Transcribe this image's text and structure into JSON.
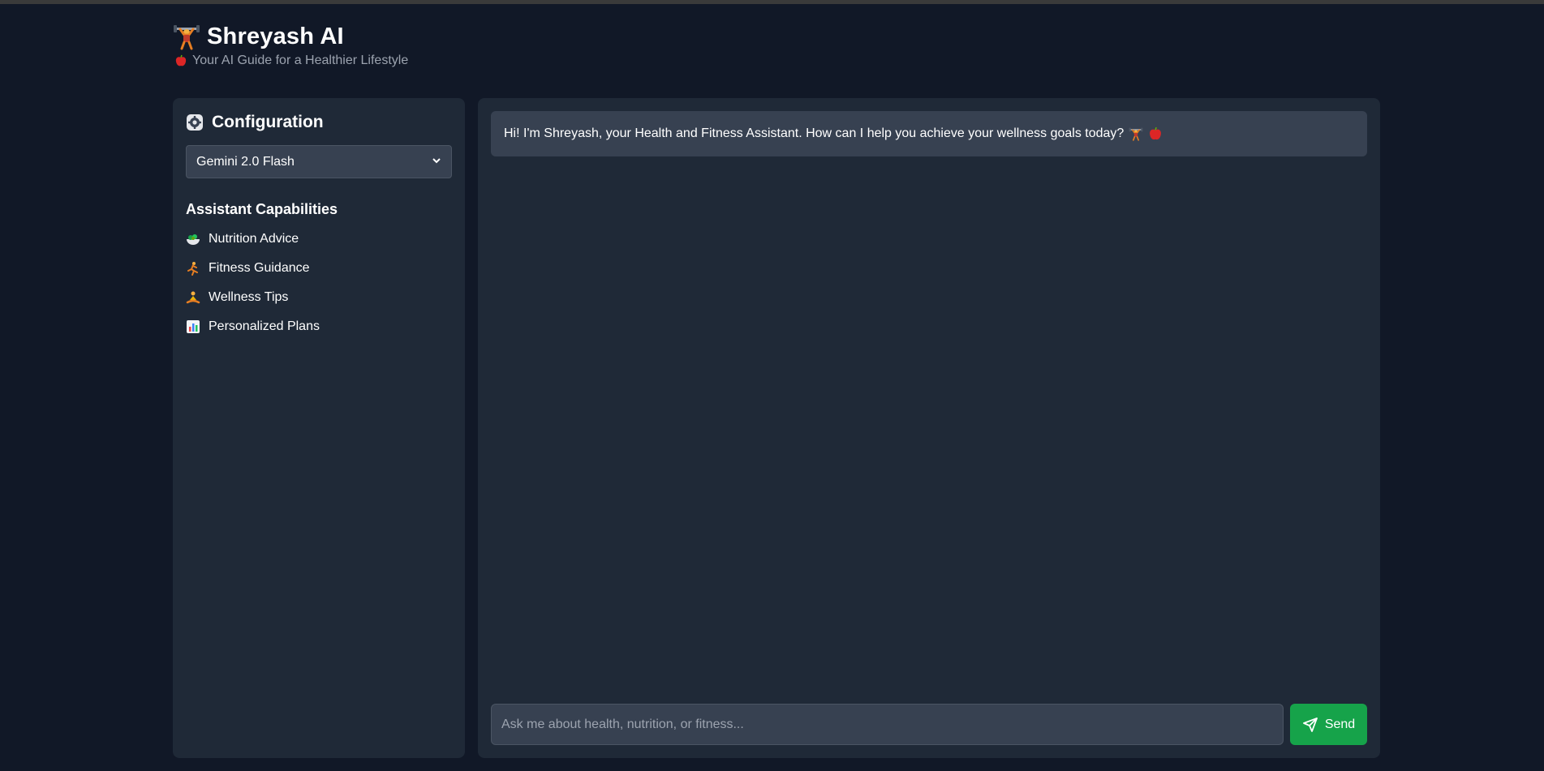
{
  "app": {
    "title": "Shreyash AI",
    "subtitle": "Your AI Guide for a Healthier Lifestyle",
    "logo_icon": "weightlifter-icon",
    "subtitle_icon": "apple-icon"
  },
  "sidebar": {
    "config_title": "Configuration",
    "config_icon": "gear-icon",
    "model_select": {
      "selected": "Gemini 2.0 Flash"
    },
    "capabilities_title": "Assistant Capabilities",
    "capabilities": [
      {
        "label": "Nutrition Advice",
        "icon": "salad-icon"
      },
      {
        "label": "Fitness Guidance",
        "icon": "runner-icon"
      },
      {
        "label": "Wellness Tips",
        "icon": "meditation-icon"
      },
      {
        "label": "Personalized Plans",
        "icon": "bar-chart-icon"
      }
    ]
  },
  "chat": {
    "messages": [
      {
        "role": "assistant",
        "text": "Hi! I'm Shreyash, your Health and Fitness Assistant. How can I help you achieve your wellness goals today?"
      }
    ],
    "input": {
      "placeholder": "Ask me about health, nutrition, or fitness...",
      "value": ""
    },
    "send_label": "Send"
  },
  "colors": {
    "background": "#111827",
    "panel": "#1f2937",
    "input": "#374151",
    "accent_green": "#16a34a",
    "muted_text": "#9ca3af"
  }
}
